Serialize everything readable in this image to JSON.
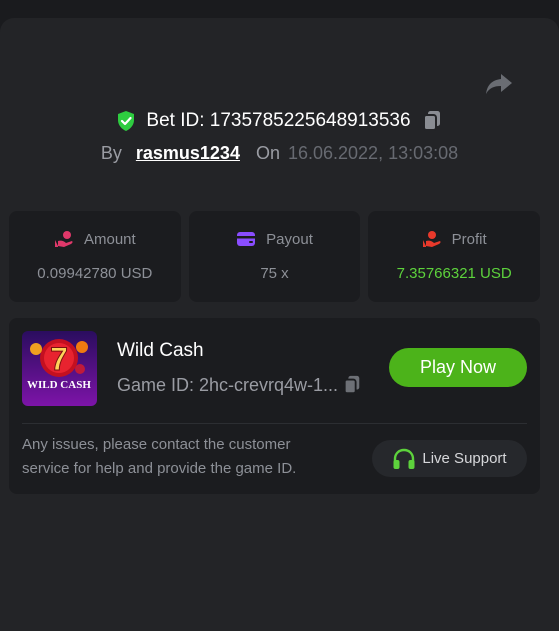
{
  "bet": {
    "id_label": "Bet ID: 1735785225648913536",
    "by_label": "By",
    "username": "rasmus1234",
    "on_label": "On",
    "datetime": "16.06.2022, 13:03:08"
  },
  "stats": {
    "amount": {
      "label": "Amount",
      "value": "0.09942780 USD"
    },
    "payout": {
      "label": "Payout",
      "value": "75 x"
    },
    "profit": {
      "label": "Profit",
      "value": "7.35766321 USD"
    }
  },
  "game": {
    "name": "Wild Cash",
    "id_label": "Game ID: 2hc-crevrq4w-1...",
    "play_label": "Play Now",
    "thumbnail_text": "WILD CASH",
    "thumbnail_number": "7"
  },
  "support": {
    "notice": "Any issues, please contact the customer service for help and provide the game ID.",
    "button_label": "Live Support"
  },
  "colors": {
    "background": "#1a1b1e",
    "panel": "#232427",
    "card": "#1b1c1f",
    "accent_green": "#4cb31a",
    "profit_green": "#5dd23c",
    "shield_green": "#2ecc40",
    "payout_purple": "#8a4dff",
    "amount_pink": "#e0386a",
    "profit_red": "#e8392b"
  },
  "icons": [
    "share-icon",
    "shield-check-icon",
    "copy-icon",
    "coin-hand-icon",
    "wallet-icon",
    "profit-hand-icon",
    "headset-icon"
  ]
}
